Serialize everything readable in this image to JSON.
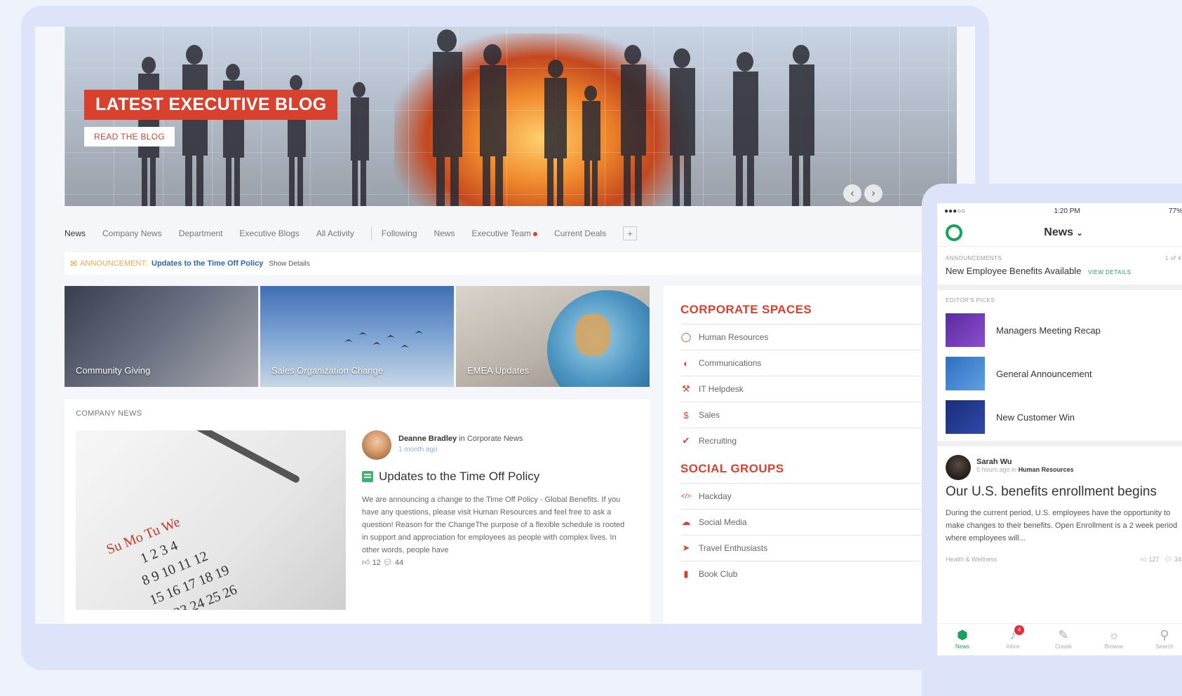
{
  "hero": {
    "title": "LATEST EXECUTIVE BLOG",
    "button": "READ THE BLOG",
    "prev": "‹",
    "next": "›"
  },
  "tabs": [
    "News",
    "Company News",
    "Department",
    "Executive Blogs",
    "All Activity",
    "Following",
    "News",
    "Executive Team",
    "Current Deals"
  ],
  "tab_add": "+",
  "announcement": {
    "label": "ANNOUNCEMENT:",
    "title": "Updates to the Time Off Policy",
    "show": "Show Details"
  },
  "tiles": [
    "Community Giving",
    "Sales Organization Change",
    "EMEA Updates"
  ],
  "company_news": {
    "heading": "COMPANY NEWS",
    "author": "Deanne Bradley",
    "in": "in",
    "space": "Corporate News",
    "ago": "1 month ago",
    "title": "Updates to the Time Off Policy",
    "body": "We are announcing a change to the Time Off Policy - Global Benefits.  If you have any questions, please visit Human Resources and feel free to ask a question!   Reason for the ChangeThe purpose of a flexible schedule is rooted in support and appreciation for employees as people with complex lives. In other words, people have",
    "likes": "12",
    "comments": "44"
  },
  "corporate_spaces": {
    "title": "CORPORATE SPACES",
    "items": [
      "Human Resources",
      "Communications",
      "IT Helpdesk",
      "Sales",
      "Recruiting"
    ]
  },
  "social_groups": {
    "title": "SOCIAL GROUPS",
    "items": [
      "Hackday",
      "Social Media",
      "Travel Enthusiasts",
      "Book Club"
    ]
  },
  "mobile": {
    "status": {
      "carrier": "●●●○○",
      "time": "1:20 PM",
      "battery": "77%"
    },
    "title": "News",
    "announcements_label": "ANNOUNCEMENTS",
    "announcement_count": "1 of 4",
    "announcement_text": "New Employee Benefits Available",
    "announcement_link": "VIEW DETAILS",
    "picks_label": "EDITOR'S PICKS",
    "picks": [
      "Managers Meeting Recap",
      "General Announcement",
      "New Customer Win"
    ],
    "post": {
      "author": "Sarah Wu",
      "ago": "5 hours ago in",
      "space": "Human Resources",
      "title": "Our U.S. benefits enrollment begins",
      "body": "During the current period, U.S. employees have the opportunity to make changes to their benefits. Open Enrollment is a 2 week period where employees will...",
      "tag": "Health & Wellness",
      "likes": "127",
      "comments": "34"
    },
    "tabbar": [
      "News",
      "Inbox",
      "Create",
      "Browse",
      "Search"
    ],
    "inbox_badge": "4"
  },
  "colors": {
    "accent": "#d7412d",
    "link": "#2c64bb",
    "green": "#17a35a"
  }
}
